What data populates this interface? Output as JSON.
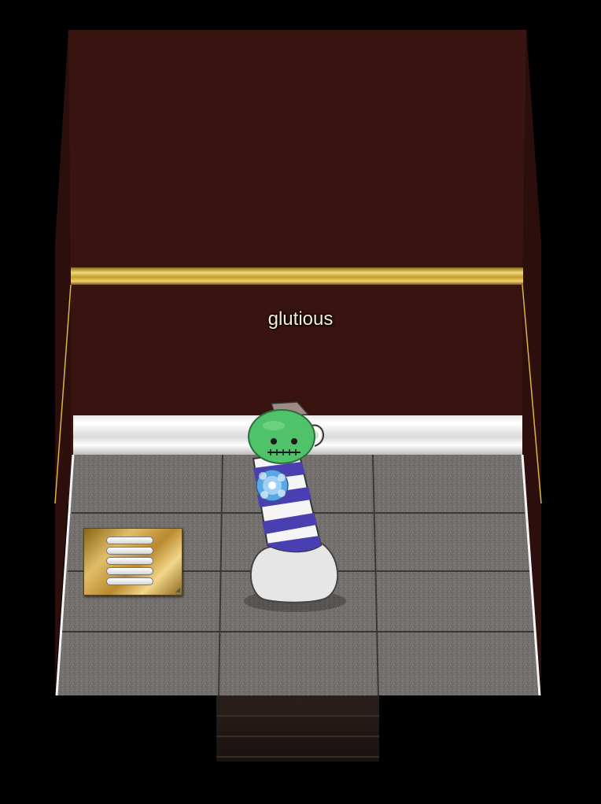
{
  "scene": {
    "room_name": "",
    "player": {
      "username": "glutious"
    },
    "colors": {
      "wall": "#3a1411",
      "trim_gold": "#d8b544",
      "baseboard": "#f2f2f2",
      "floor_tile": "#7d7977",
      "avatar_head": "#4fc26a",
      "avatar_stripe": "#4a3fb0"
    },
    "sign": {
      "button_count": 5,
      "icons": [
        "arrow-icon",
        "resize-icon"
      ]
    }
  }
}
